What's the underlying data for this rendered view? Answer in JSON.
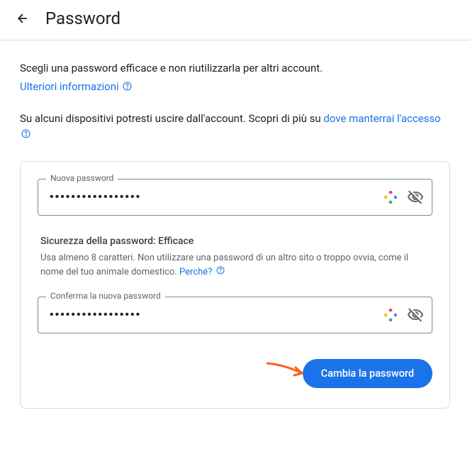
{
  "header": {
    "title": "Password"
  },
  "intro": {
    "description": "Scegli una password efficace e non riutilizzarla per altri account.",
    "more_info_label": "Ulteriori informazioni"
  },
  "logout_notice": {
    "text_before": "Su alcuni dispositivi potresti uscire dall'account. Scopri di più su ",
    "link_text": "dove manterrai l'accesso"
  },
  "form": {
    "new_password": {
      "label": "Nuova password",
      "value": "•••••••••••••••••"
    },
    "strength": {
      "title": "Sicurezza della password: Efficace",
      "desc_text": "Usa almeno 8 caratteri. Non utilizzare una password di un altro sito o troppo ovvia, come il nome del tuo animale domestico. ",
      "why_link": "Perché?"
    },
    "confirm_password": {
      "label": "Conferma la nuova password",
      "value": "•••••••••••••••••"
    },
    "submit_label": "Cambia la password"
  }
}
